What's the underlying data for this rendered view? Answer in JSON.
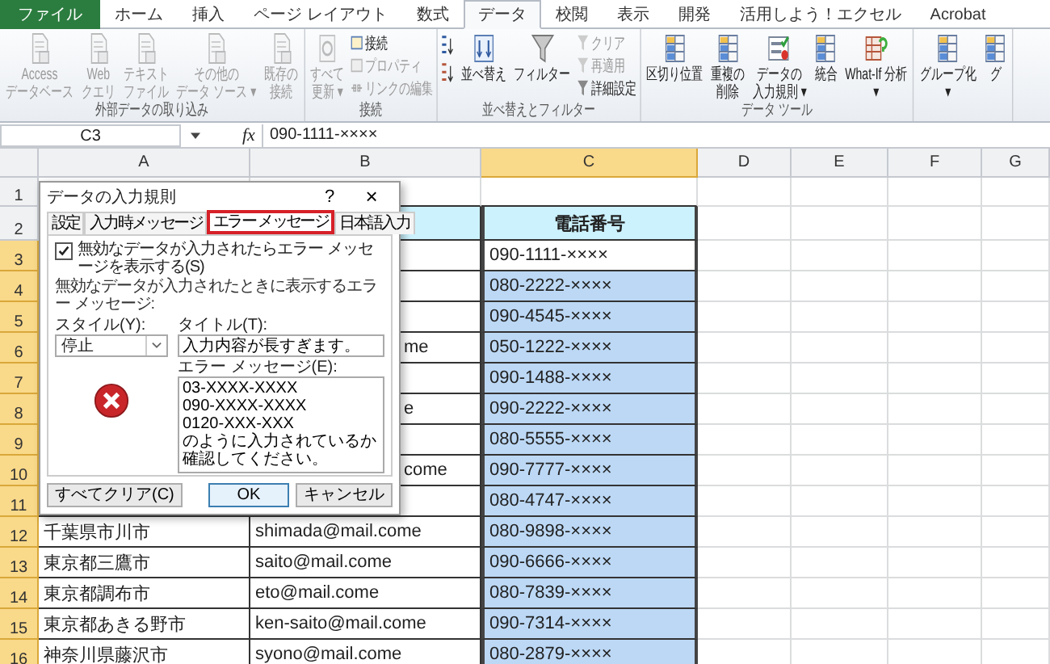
{
  "ribbon_tabs": [
    {
      "label": "ファイル",
      "kind": "file",
      "selected": false
    },
    {
      "label": "ホーム",
      "kind": "tab",
      "selected": false
    },
    {
      "label": "挿入",
      "kind": "tab",
      "selected": false
    },
    {
      "label": "ページ レイアウト",
      "kind": "tab",
      "selected": false
    },
    {
      "label": "数式",
      "kind": "tab",
      "selected": false
    },
    {
      "label": "データ",
      "kind": "tab",
      "selected": true
    },
    {
      "label": "校閲",
      "kind": "tab",
      "selected": false
    },
    {
      "label": "表示",
      "kind": "tab",
      "selected": false
    },
    {
      "label": "開発",
      "kind": "tab",
      "selected": false
    },
    {
      "label": "活用しよう！エクセル",
      "kind": "tab",
      "selected": false
    },
    {
      "label": "Acrobat",
      "kind": "tab",
      "selected": false
    }
  ],
  "ribbon_groups": [
    {
      "label": "外部データの取り込み",
      "items": [
        {
          "kind": "large",
          "lines": [
            "Access",
            "データベース"
          ],
          "disabled": true
        },
        {
          "kind": "large",
          "lines": [
            "Web",
            "クエリ"
          ],
          "disabled": true
        },
        {
          "kind": "large",
          "lines": [
            "テキスト",
            "ファイル"
          ],
          "disabled": true
        },
        {
          "kind": "large",
          "lines": [
            "その他の",
            "データ ソース ▾"
          ],
          "disabled": true
        },
        {
          "kind": "large",
          "lines": [
            "既存の",
            "接続"
          ],
          "disabled": true
        }
      ]
    },
    {
      "label": "接続",
      "items": [
        {
          "kind": "large",
          "lines": [
            "すべて",
            "更新 ▾"
          ],
          "disabled": true
        },
        {
          "kind": "small_stack",
          "entries": [
            {
              "label": "接続",
              "disabled": false
            },
            {
              "label": "プロパティ",
              "disabled": true
            },
            {
              "label": "リンクの編集",
              "disabled": true
            }
          ]
        }
      ]
    },
    {
      "label": "並べ替えとフィルター",
      "items": [
        {
          "kind": "sort_icons"
        },
        {
          "kind": "large",
          "lines": [
            "並べ替え"
          ],
          "disabled": false
        },
        {
          "kind": "large",
          "lines": [
            "フィルター"
          ],
          "disabled": false
        },
        {
          "kind": "small_stack",
          "entries": [
            {
              "label": "クリア",
              "disabled": true
            },
            {
              "label": "再適用",
              "disabled": true
            },
            {
              "label": "詳細設定",
              "disabled": false
            }
          ]
        }
      ]
    },
    {
      "label": "データ ツール",
      "items": [
        {
          "kind": "large",
          "lines": [
            "区切り位置"
          ],
          "disabled": false
        },
        {
          "kind": "large",
          "lines": [
            "重複の",
            "削除"
          ],
          "disabled": false
        },
        {
          "kind": "large",
          "lines": [
            "データの",
            "入力規則 ▾"
          ],
          "disabled": false
        },
        {
          "kind": "large",
          "lines": [
            "統合"
          ],
          "disabled": false
        },
        {
          "kind": "large",
          "lines": [
            "What-If 分析",
            "▾"
          ],
          "disabled": false
        }
      ]
    },
    {
      "items": [
        {
          "kind": "large",
          "lines": [
            "グループ化",
            "▾"
          ],
          "disabled": false
        },
        {
          "kind": "large",
          "lines": [
            "グ"
          ]
        }
      ]
    }
  ],
  "formula_bar": {
    "name_box": "C3",
    "function_label": "fx",
    "formula": "090-1111-××××"
  },
  "columns": [
    {
      "label": "A",
      "selected": false
    },
    {
      "label": "B",
      "selected": false
    },
    {
      "label": "C",
      "selected": true
    },
    {
      "label": "D",
      "selected": false
    },
    {
      "label": "E",
      "selected": false
    },
    {
      "label": "F",
      "selected": false
    },
    {
      "label": "G",
      "selected": false
    }
  ],
  "rows": [
    {
      "number": "1",
      "kind": "blank",
      "selected": false
    },
    {
      "number": "2",
      "kind": "header",
      "selected": false,
      "c": "電話番号"
    },
    {
      "number": "3",
      "kind": "data",
      "selected": true,
      "c": "090-1111-××××",
      "active": true
    },
    {
      "number": "4",
      "kind": "data",
      "selected": true,
      "c": "080-2222-××××",
      "active": false
    },
    {
      "number": "5",
      "kind": "data",
      "selected": true,
      "c": "090-4545-××××",
      "active": false
    },
    {
      "number": "6",
      "kind": "data",
      "selected": true,
      "b": "me",
      "c": "050-1222-××××",
      "active": false
    },
    {
      "number": "7",
      "kind": "data",
      "selected": true,
      "c": "090-1488-××××",
      "active": false
    },
    {
      "number": "8",
      "kind": "data",
      "selected": true,
      "b": "e",
      "c": "090-2222-××××",
      "active": false
    },
    {
      "number": "9",
      "kind": "data",
      "selected": true,
      "c": "080-5555-××××",
      "active": false
    },
    {
      "number": "10",
      "kind": "data",
      "selected": true,
      "b": "come",
      "c": "090-7777-××××",
      "active": false
    },
    {
      "number": "11",
      "kind": "data",
      "selected": true,
      "c": "080-4747-××××",
      "active": false
    },
    {
      "number": "12",
      "kind": "data",
      "selected": true,
      "a": "千葉県市川市",
      "b": "shimada@mail.come",
      "c": "080-9898-××××",
      "active": false
    },
    {
      "number": "13",
      "kind": "data",
      "selected": true,
      "a": "東京都三鷹市",
      "b": "saito@mail.come",
      "c": "090-6666-××××",
      "active": false
    },
    {
      "number": "14",
      "kind": "data",
      "selected": true,
      "a": "東京都調布市",
      "b": "eto@mail.come",
      "c": "080-7839-××××",
      "active": false
    },
    {
      "number": "15",
      "kind": "data",
      "selected": true,
      "a": "東京都あきる野市",
      "b": "ken-saito@mail.come",
      "c": "090-7314-××××",
      "active": false
    },
    {
      "number": "16",
      "kind": "data",
      "selected": true,
      "a": "神奈川県藤沢市",
      "b": "syono@mail.come",
      "c": "080-2879-××××",
      "active": false
    }
  ],
  "dialog": {
    "title": "データの入力規則",
    "help": "?",
    "close": "×",
    "tabs": [
      {
        "label": "設定",
        "selected": false
      },
      {
        "label": "入力時メッセージ",
        "selected": false
      },
      {
        "label": "エラー メッセージ",
        "selected": true
      },
      {
        "label": "日本語入力",
        "selected": false
      }
    ],
    "show_error": {
      "label": "無効なデータが入力されたらエラー メッセージを表示する(S)",
      "checked": true
    },
    "section_label": "無効なデータが入力されたときに表示するエラー メッセージ:",
    "style": {
      "label": "スタイル(Y):",
      "value": "停止"
    },
    "title_field": {
      "label": "タイトル(T):",
      "value": "入力内容が長すぎます。"
    },
    "message_field": {
      "label": "エラー メッセージ(E):",
      "value": "03-XXXX-XXXX\n090-XXXX-XXXX\n0120-XXX-XXX\nのように入力されているか確認してください。"
    },
    "buttons": [
      {
        "label": "すべてクリア(C)",
        "kind": "clear"
      },
      {
        "label": "OK",
        "kind": "ok"
      },
      {
        "label": "キャンセル",
        "kind": "cancel"
      }
    ]
  }
}
